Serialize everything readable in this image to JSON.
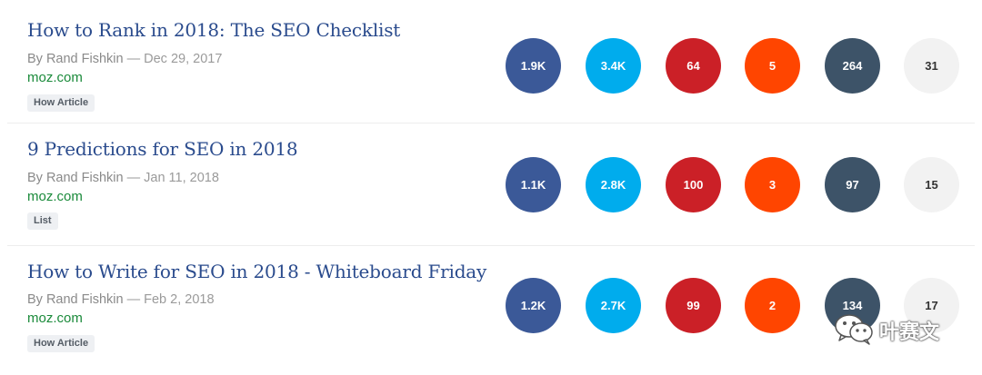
{
  "colors": {
    "facebook": "#3b5998",
    "twitter": "#00aced",
    "pinterest": "#cb2027",
    "reddit": "#ff4500",
    "links": "#3d5368",
    "evergreen": "#f2f2f2"
  },
  "articles": [
    {
      "title": "How to Rank in 2018: The SEO Checklist",
      "author": "By Rand Fishkin",
      "date": "— Dec 29, 2017",
      "domain": "moz.com",
      "tag": "How Article",
      "metrics": {
        "facebook": "1.9K",
        "twitter": "3.4K",
        "pinterest": "64",
        "reddit": "5",
        "links": "264",
        "evergreen": "31"
      }
    },
    {
      "title": "9 Predictions for SEO in 2018",
      "author": "By Rand Fishkin",
      "date": "— Jan 11, 2018",
      "domain": "moz.com",
      "tag": "List",
      "metrics": {
        "facebook": "1.1K",
        "twitter": "2.8K",
        "pinterest": "100",
        "reddit": "3",
        "links": "97",
        "evergreen": "15"
      }
    },
    {
      "title": "How to Write for SEO in 2018 - Whiteboard Friday",
      "author": "By Rand Fishkin",
      "date": "— Feb 2, 2018",
      "domain": "moz.com",
      "tag": "How Article",
      "metrics": {
        "facebook": "1.2K",
        "twitter": "2.7K",
        "pinterest": "99",
        "reddit": "2",
        "links": "134",
        "evergreen": "17"
      }
    }
  ],
  "watermark": {
    "text": "叶赛文",
    "icon": "wechat-icon"
  }
}
